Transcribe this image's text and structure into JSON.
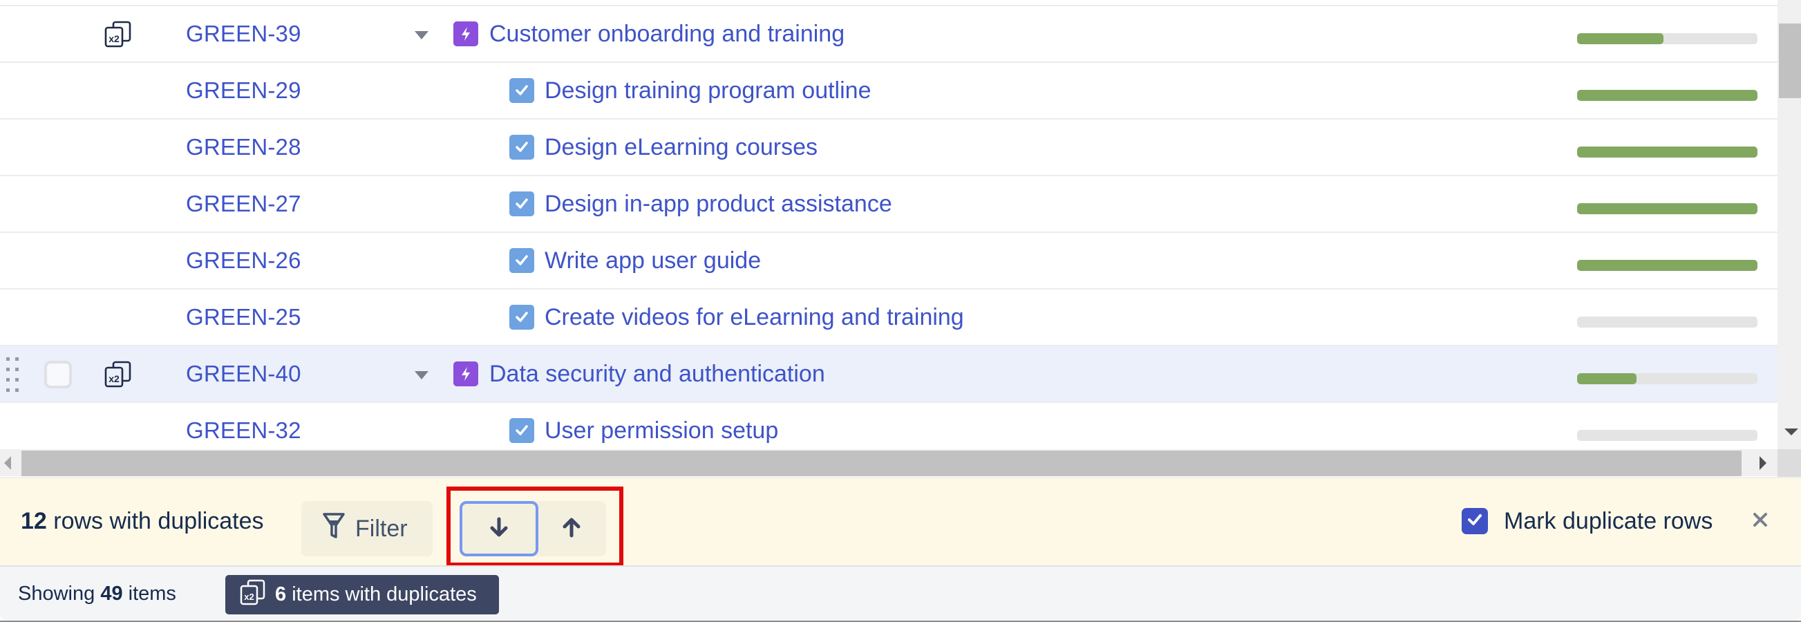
{
  "grid": {
    "rows": [
      {
        "key": "GREEN-39",
        "type": "epic",
        "summary": "Customer onboarding and training",
        "has_duplicate_icon": true,
        "expanded": true,
        "progress": 0.48,
        "highlighted": false
      },
      {
        "key": "GREEN-29",
        "type": "task",
        "summary": "Design training program outline",
        "has_duplicate_icon": false,
        "progress": 1.0,
        "highlighted": false
      },
      {
        "key": "GREEN-28",
        "type": "task",
        "summary": "Design eLearning courses",
        "has_duplicate_icon": false,
        "progress": 1.0,
        "highlighted": false
      },
      {
        "key": "GREEN-27",
        "type": "task",
        "summary": "Design in-app product assistance",
        "has_duplicate_icon": false,
        "progress": 1.0,
        "highlighted": false
      },
      {
        "key": "GREEN-26",
        "type": "task",
        "summary": "Write app user guide",
        "has_duplicate_icon": false,
        "progress": 1.0,
        "highlighted": false
      },
      {
        "key": "GREEN-25",
        "type": "task",
        "summary": "Create videos for eLearning and training",
        "has_duplicate_icon": false,
        "progress": 0.0,
        "highlighted": false
      },
      {
        "key": "GREEN-40",
        "type": "epic",
        "summary": "Data security and authentication",
        "has_duplicate_icon": true,
        "expanded": true,
        "progress": 0.33,
        "highlighted": true
      },
      {
        "key": "GREEN-32",
        "type": "task",
        "summary": "User permission setup",
        "has_duplicate_icon": false,
        "progress": 0.0,
        "highlighted": false
      }
    ],
    "duplicate_icon_text": "x2"
  },
  "duplicates_bar": {
    "count": "12",
    "count_suffix": " rows with duplicates",
    "filter_label": "Filter",
    "next_button_icon": "arrow-down-icon",
    "prev_button_icon": "arrow-up-icon",
    "mark_duplicates_label": "Mark duplicate rows",
    "mark_duplicates_checked": true
  },
  "footer": {
    "showing_prefix": "Showing ",
    "showing_count": "49",
    "showing_suffix": " items",
    "badge_count": "6",
    "badge_suffix": " items with duplicates"
  },
  "colors": {
    "link": "#3e53c8",
    "epic": "#8b4fdc",
    "task": "#6ea2e0",
    "progress_fill": "#82a860",
    "progress_track": "#e4e4e4",
    "row_highlight": "#ebf0fa",
    "dup_bar_bg": "#fdf9e6",
    "checkbox_checked": "#3f51c5",
    "focus_ring": "#7899f0",
    "annotation_box": "#e10a0a",
    "badge_bg": "#3d4663"
  }
}
